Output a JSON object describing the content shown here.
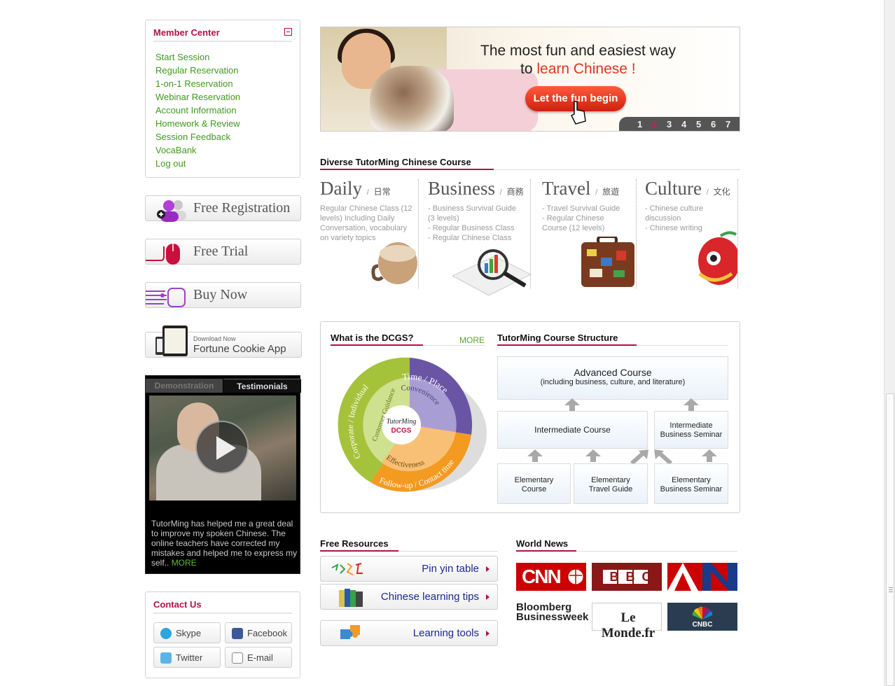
{
  "member_center": {
    "title": "Member Center",
    "links": [
      "Start Session",
      "Regular Reservation",
      "1-on-1 Reservation",
      "Webinar Reservation",
      "Account Information",
      "Homework & Review",
      "Session Feedback",
      "VocaBank",
      "Log out"
    ]
  },
  "side_buttons": {
    "free_registration": "Free Registration",
    "free_trial": "Free Trial",
    "buy_now": "Buy Now",
    "app_small": "Download Now",
    "app_big": "Fortune Cookie App"
  },
  "testimonials": {
    "tab_demo": "Demonstration",
    "tab_testimonials": "Testimonials",
    "text": "TutorMing has helped me a great deal to improve my spoken Chinese. The online teachers have corrected my mistakes and helped me to express my self..",
    "more": "MORE"
  },
  "contact": {
    "title": "Contact Us",
    "skype": "Skype",
    "facebook": "Facebook",
    "twitter": "Twitter",
    "email": "E-mail"
  },
  "banner": {
    "line1": "The most fun and easiest way",
    "line2_prefix": "to ",
    "line2_highlight": "learn Chinese !",
    "cta": "Let the fun begin",
    "pages": [
      "1",
      "2",
      "3",
      "4",
      "5",
      "6",
      "7"
    ],
    "active_page": "2"
  },
  "courses": {
    "section_title": "Diverse TutorMing Chinese Course",
    "items": [
      {
        "name": "Daily",
        "slash": "/",
        "zh": "日常",
        "desc": "Regular Chinese Class (12\nlevels)  Including Daily\nConversation, vocabulary\non variety topics"
      },
      {
        "name": "Business",
        "slash": "/",
        "zh": "商務",
        "desc": "- Business Survival Guide\n   (3 levels)\n- Regular Business Class\n- Regular Chinese Class"
      },
      {
        "name": "Travel",
        "slash": "/",
        "zh": "旅遊",
        "desc": "- Travel Survival  Guide\n- Regular  Chinese\n  Course  (12 levels)"
      },
      {
        "name": "Culture",
        "slash": "/",
        "zh": "文化",
        "desc": "- Chinese culture\n   discussion\n- Chinese writing"
      }
    ]
  },
  "dcgs": {
    "title": "What is the DCGS?",
    "more": "MORE",
    "wheel": {
      "outer_top": "Time / Place",
      "outer_left": "Corporate / Individual",
      "outer_bottom": "Follow-up / Contact time",
      "inner_top": "Convenience",
      "inner_left": "Customer Guidance",
      "inner_bottom": "Effectiveness",
      "center_logo": "TutorMing",
      "center_label": "DCGS"
    }
  },
  "structure": {
    "title": "TutorMing Course Structure",
    "advanced": "Advanced Course",
    "advanced_sub": "(including business, culture, and literature)",
    "intermediate": "Intermediate Course",
    "intermediate_seminar_1": "Intermediate",
    "intermediate_seminar_2": "Business Seminar",
    "elementary_1": "Elementary",
    "elementary_1b": "Course",
    "elementary_2": "Elementary",
    "elementary_2b": "Travel Guide",
    "elementary_3": "Elementary",
    "elementary_3b": "Business Seminar"
  },
  "resources": {
    "title": "Free Resources",
    "items": [
      "Pin yin table",
      "Chinese learning tips",
      "Learning tools"
    ]
  },
  "news": {
    "title": "World News",
    "sources": [
      "CNN",
      "BBC",
      "AN",
      "Bloomberg",
      "Businessweek",
      "Le Monde.fr",
      "CNBC"
    ]
  },
  "colors": {
    "accent": "#b0124a",
    "link_green": "#3e9a1e",
    "link_blue": "#1b2a8f"
  }
}
